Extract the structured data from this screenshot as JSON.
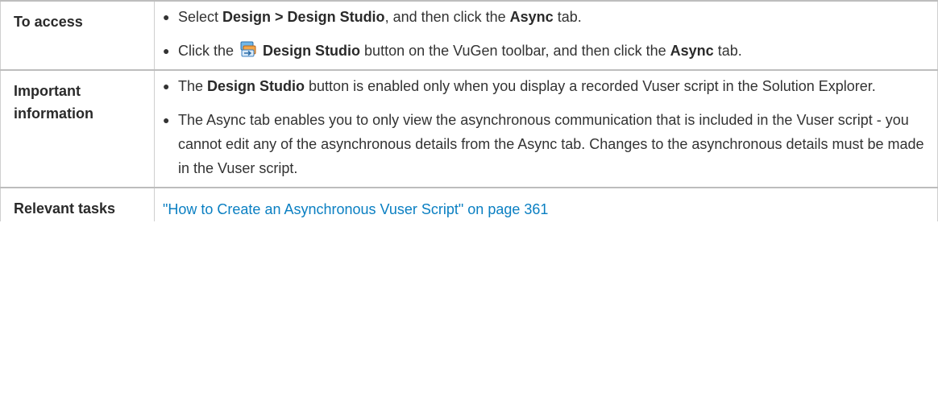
{
  "rows": [
    {
      "label": "To access",
      "items": [
        {
          "parts": [
            "Select ",
            "Design > Design Studio",
            ", and then click the ",
            "Async",
            " tab."
          ]
        },
        {
          "parts": [
            "Click the ",
            "Design Studio",
            " button on the VuGen toolbar, and then click the ",
            "Async",
            " tab."
          ],
          "icon": "design-studio-icon"
        }
      ]
    },
    {
      "label": "Important information",
      "items": [
        {
          "parts": [
            "The ",
            "Design Studio",
            " button is enabled only when you display a recorded Vuser script in the Solution Explorer."
          ]
        },
        {
          "text": "The Async tab enables you to only view the asynchronous communication that is included in the Vuser script - you cannot edit any of the asynchronous details from the Async tab. Changes to the asynchronous details must be made in the Vuser script."
        }
      ]
    },
    {
      "label": "Relevant tasks",
      "link": "\"How to Create an Asynchronous Vuser Script\" on page 361"
    }
  ],
  "colors": {
    "link": "#0a7fc2",
    "text": "#333333",
    "border": "#bdbdbd"
  }
}
